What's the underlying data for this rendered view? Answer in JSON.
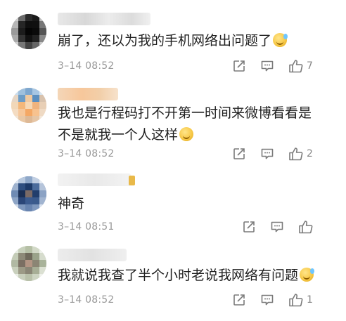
{
  "comments": [
    {
      "text": "崩了，还以为我的手机网络出问题了",
      "emoji": "laugh-cry-emoji",
      "time": "3–14 08:52",
      "like_count": "7"
    },
    {
      "text": "我也是行程码打不开第一时间来微博看看是不是就我一个人这样",
      "emoji": "thinking-emoji",
      "time": "3–14 08:52",
      "like_count": "2"
    },
    {
      "text": "神奇",
      "emoji": "",
      "time": "3–14 08:51",
      "like_count": ""
    },
    {
      "text": "我就说我查了半个小时老说我网络有问题",
      "emoji": "laugh-cry-emoji",
      "time": "3–14 08:52",
      "like_count": "1"
    }
  ],
  "colors": {
    "text": "#1f1f1f",
    "meta": "#999999",
    "icon": "#7a7a7a"
  }
}
